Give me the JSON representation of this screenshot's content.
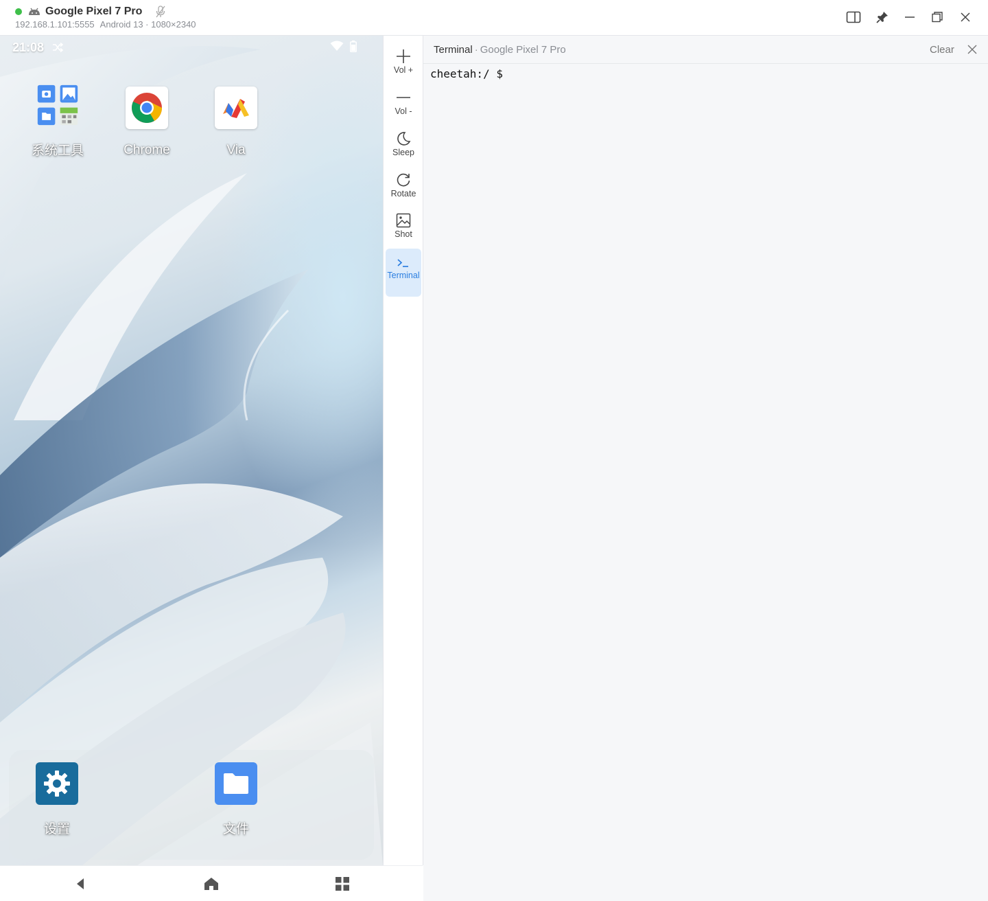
{
  "window": {
    "title": "Google Pixel 7 Pro",
    "address": "192.168.1.101:5555",
    "info": "Android 13 · 1080×2340",
    "status_color": "#3fbf4a",
    "controls": [
      "sidebar-toggle-icon",
      "pin-icon",
      "minimize-icon",
      "maximize-icon",
      "close-icon"
    ]
  },
  "phone": {
    "status_bar": {
      "time": "21:08"
    },
    "apps": [
      {
        "label": "系统工具",
        "icon": "folder-icon"
      },
      {
        "label": "Chrome",
        "icon": "chrome-icon"
      },
      {
        "label": "Via",
        "icon": "via-icon"
      }
    ],
    "dock": [
      {
        "label": "设置",
        "icon": "settings-icon"
      },
      {
        "label": "文件",
        "icon": "files-icon"
      }
    ],
    "nav": [
      "back-icon",
      "home-icon",
      "recents-icon"
    ]
  },
  "tools": [
    {
      "label": "Vol +",
      "icon": "volume-up-icon"
    },
    {
      "label": "Vol -",
      "icon": "volume-down-icon"
    },
    {
      "label": "Sleep",
      "icon": "moon-icon"
    },
    {
      "label": "Rotate",
      "icon": "rotate-icon"
    },
    {
      "label": "Shot",
      "icon": "screenshot-icon"
    },
    {
      "label": "Terminal",
      "icon": "terminal-icon",
      "active": true
    }
  ],
  "terminal": {
    "title": "Terminal",
    "device": "Google Pixel 7 Pro",
    "clear_label": "Clear",
    "prompt": "cheetah:/ $"
  },
  "colors": {
    "accent": "#2b7ee0",
    "active_tool_bg": "#dcebfb",
    "terminal_bg": "#f6f7f9"
  }
}
